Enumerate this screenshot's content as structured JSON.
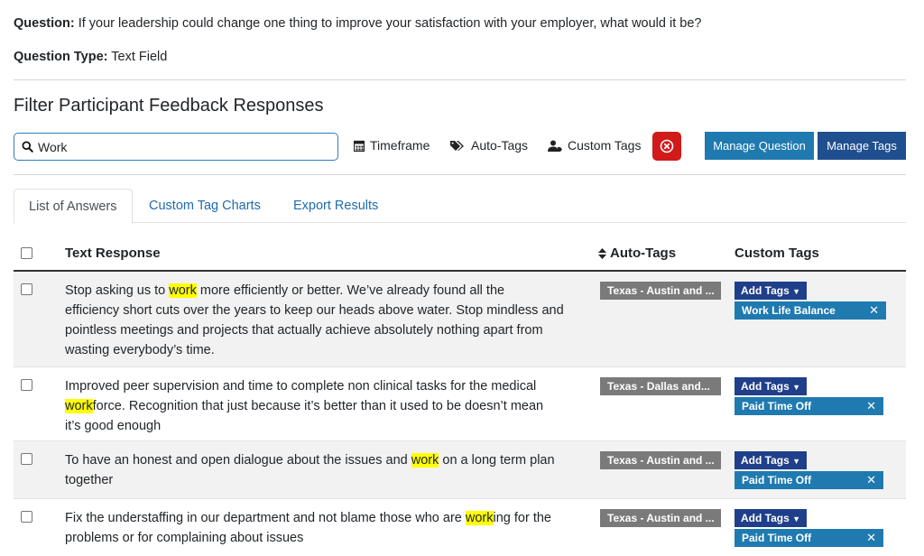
{
  "question": {
    "label": "Question:",
    "text": "If your leadership could change one thing to improve your satisfaction with your employer, what would it be?",
    "type_label": "Question Type:",
    "type_value": "Text Field"
  },
  "filter": {
    "title": "Filter Participant Feedback Responses",
    "search_value": "Work",
    "timeframe": "Timeframe",
    "auto_tags": "Auto-Tags",
    "custom_tags": "Custom Tags",
    "manage_question": "Manage Question",
    "manage_tags": "Manage Tags"
  },
  "tabs": [
    "List of Answers",
    "Custom Tag Charts",
    "Export Results"
  ],
  "table": {
    "headers": {
      "text": "Text Response",
      "auto": "Auto-Tags",
      "custom": "Custom Tags"
    },
    "add_tags_label": "Add Tags",
    "rows": [
      {
        "pre": "Stop asking us to ",
        "hl": "work",
        "post1": " more efficiently or better. We’ve already found all the",
        "line2": "efficiency short cuts over the years to keep our heads above water. Stop mindless and",
        "line3": "pointless meetings and projects that actually achieve absolutely nothing apart from",
        "line4": "wasting everybody’s time.",
        "auto_tag": "Texas - Austin and ...",
        "custom_tag": "Work Life Balance"
      },
      {
        "line1": "Improved peer supervision and time to complete non clinical tasks for the medical",
        "hl": "work",
        "post2": "force. Recognition that just because it’s better than it used to be doesn’t mean",
        "line3": "it’s good enough",
        "auto_tag": "Texas - Dallas and...",
        "custom_tag": "Paid Time Off"
      },
      {
        "pre": "To have an honest and open dialogue about the issues and ",
        "hl": "work",
        "post1": " on a long term plan",
        "line2": "together",
        "auto_tag": "Texas - Austin and ...",
        "custom_tag": "Paid Time Off"
      },
      {
        "pre": "Fix the understaffing in our department and not blame those who are ",
        "hl": "work",
        "post1": "ing for the",
        "line2": "problems or for complaining about issues",
        "auto_tag": "Texas - Austin and ...",
        "custom_tag": "Paid Time Off"
      }
    ]
  }
}
